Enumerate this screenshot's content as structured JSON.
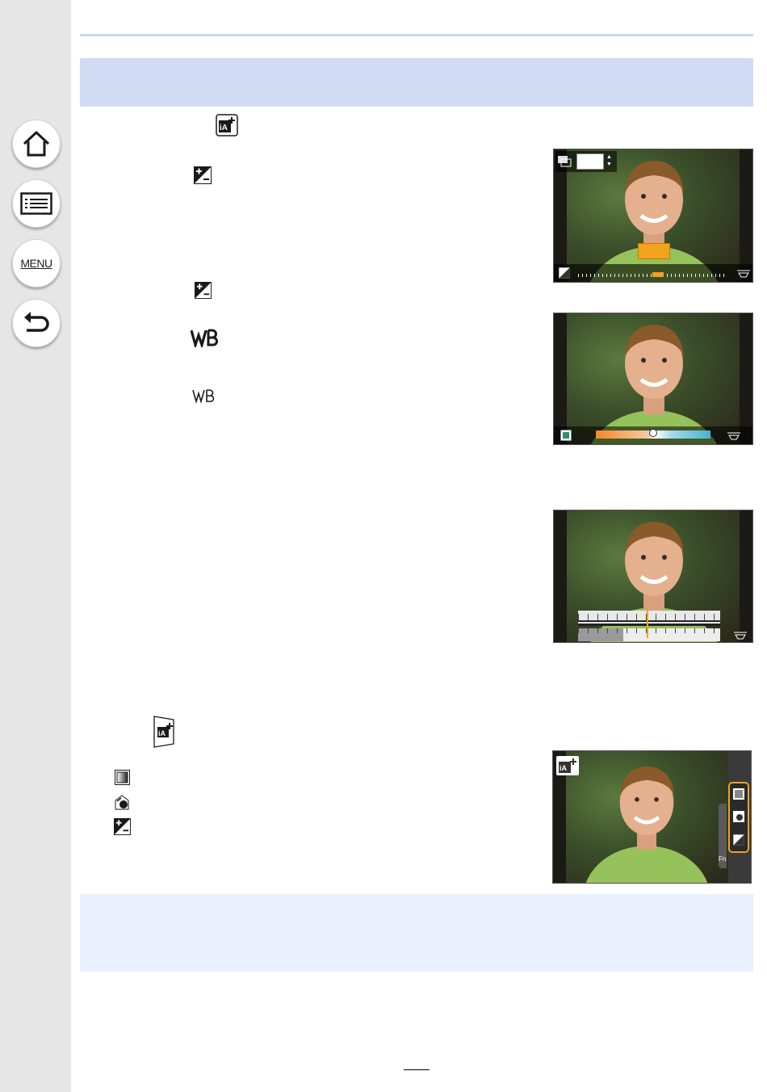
{
  "sidebar": {
    "home_icon": "home-icon",
    "contents_icon": "list-icon",
    "menu_label": "MENU",
    "back_icon": "back-arrow-icon"
  },
  "page": {
    "page_number": ""
  },
  "screens": [
    {
      "name": "exposure-compensation-screen",
      "icons": [
        "bracket-icon",
        "exposure-compensation-icon",
        "dial-icon"
      ],
      "has_scale": true
    },
    {
      "name": "white-balance-screen",
      "icons": [
        "white-balance-frame-icon",
        "dial-icon"
      ],
      "has_color_bar": true
    },
    {
      "name": "adjustment-screen",
      "icons": [
        "dial-icon"
      ],
      "has_dual_scale": true
    },
    {
      "name": "ia-plus-screen",
      "icons": [
        "ia-plus-icon",
        "defocus-icon",
        "brightness-icon",
        "exposure-compensation-icon"
      ],
      "side_label": "Fn"
    }
  ],
  "colors": {
    "sidebar": "#e6e6e6",
    "heading_band": "#d0dcf3",
    "note_band": "#eaf1fd",
    "rule": "#c9d7ec",
    "highlight_orange": "#f2a21c"
  }
}
